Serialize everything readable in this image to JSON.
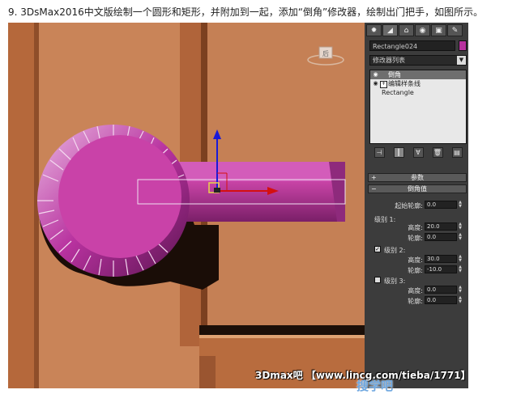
{
  "caption": "9. 3DsMax2016中文版绘制一个圆形和矩形，并附加到一起，添加“倒角”修改器，绘制出门把手，如图所示。",
  "viewport": {
    "cube_label": "后"
  },
  "panel": {
    "tabs": [
      "create-icon",
      "modify-icon",
      "hierarchy-icon",
      "motion-icon",
      "display-icon",
      "utilities-icon"
    ],
    "object_name": "Rectangle024",
    "object_color": "#b8329f",
    "modifier_list_label": "修改器列表",
    "stack": [
      {
        "label": "倒角",
        "selected": true
      },
      {
        "label": "编辑样条线",
        "selected": false
      },
      {
        "label": "Rectangle",
        "selected": false
      }
    ],
    "rollout_params": "参数",
    "rollout_bevel": "倒角值",
    "start_outline_label": "起始轮廓:",
    "start_outline_value": "0.0",
    "level1_label": "级别 1:",
    "level1_height_label": "高度:",
    "level1_height_value": "20.0",
    "level1_outline_label": "轮廓:",
    "level1_outline_value": "0.0",
    "level2_label": "级别 2:",
    "level2_checked": true,
    "level2_height_label": "高度:",
    "level2_height_value": "30.0",
    "level2_outline_label": "轮廓:",
    "level2_outline_value": "-10.0",
    "level3_label": "级别 3:",
    "level3_checked": false,
    "level3_height_label": "高度:",
    "level3_height_value": "0.0",
    "level3_outline_label": "轮廓:",
    "level3_outline_value": "0.0"
  },
  "watermark": "3Dmax吧 【www.lincg.com/tieba/1771】",
  "watermark2": "搜学吧",
  "colors": {
    "background": "#c98458",
    "handle": "#b8329f",
    "gizmo_x": "#cc0000",
    "gizmo_y": "#0000cc"
  }
}
